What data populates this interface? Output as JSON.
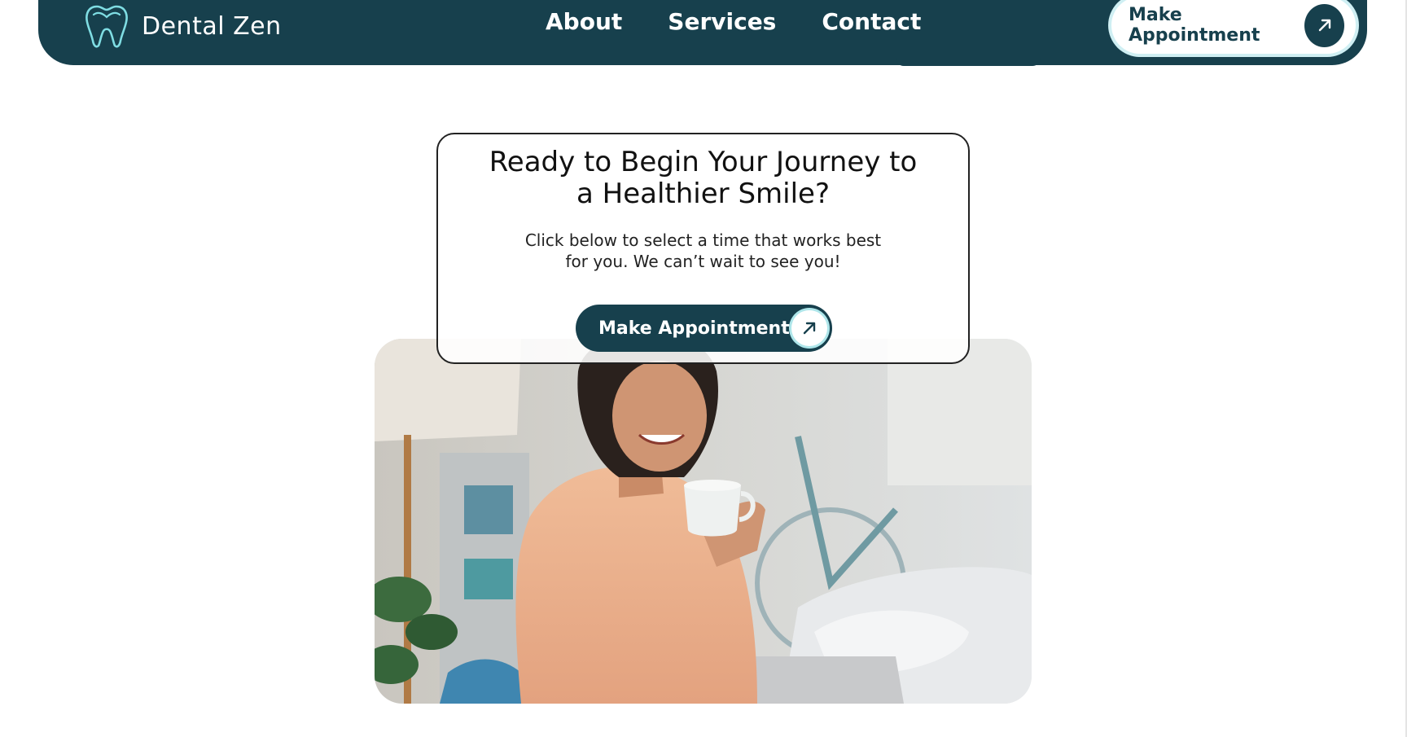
{
  "brand": {
    "name": "Dental Zen",
    "icon": "tooth-logo-icon"
  },
  "nav": {
    "links": [
      {
        "label": "About"
      },
      {
        "label": "Services"
      },
      {
        "label": "Contact"
      }
    ],
    "cta_label": "Make Appointment",
    "cta_icon": "arrow-up-right-icon"
  },
  "hero": {
    "title": "Ready to Begin Your Journey to a Healthier Smile?",
    "text": "Click below to select a time that works best for you. We can’t wait to see you!",
    "cta_label": "Make Appointment",
    "cta_icon": "arrow-up-right-icon",
    "photo": "woman-drinking-coffee-photo"
  },
  "colors": {
    "primary": "#17404d",
    "accent": "#7fdde3",
    "ring": "#cfeff3"
  }
}
